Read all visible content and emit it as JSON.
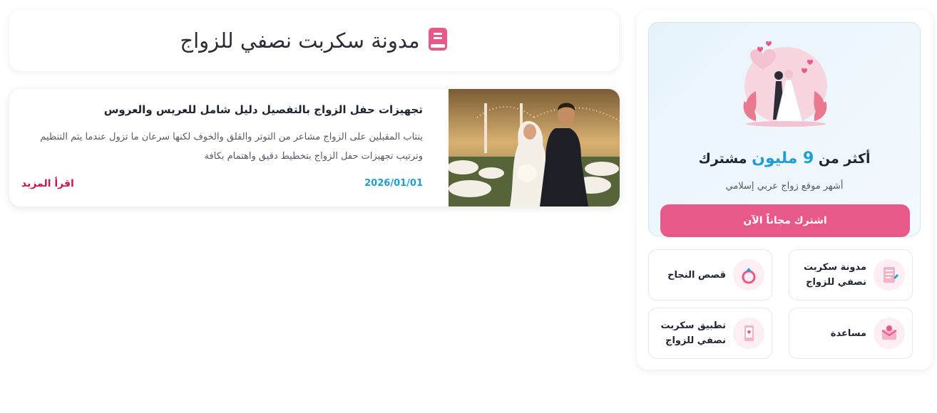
{
  "blog": {
    "title": "مدونة سكربت نصفي للزواج",
    "title_icon": "book-icon",
    "posts": [
      {
        "title": "تجهيزات حفل الزواج بالتفصيل دليل شامل للعريس والعروس",
        "excerpt": "ينتاب المقبلين على الزواج مشاعر من التوتر والقلق والخوف لكنها سرعان ما تزول عندما يتم التنظيم وترتيب تجهيزات حفل الزواج بتخطيط دقيق واهتمام بكافة",
        "date": "2026/01/01",
        "read_more": "اقرأ المزيد",
        "image": "wedding-couple-photo"
      }
    ]
  },
  "promo": {
    "prefix": "أكثر من",
    "highlight": "9 مليون",
    "suffix": "مشترك",
    "subtitle": "أشهر موقع زواج عربي إسلامي",
    "cta": "اشترك مجاناً الآن",
    "illustration": "wedding-couple-hearts"
  },
  "quick_links": [
    {
      "label": "مدونة سكربت نصفي للزواج",
      "icon": "blog-icon"
    },
    {
      "label": "قصص النجاح",
      "icon": "ring-icon"
    },
    {
      "label": "مساعدة",
      "icon": "help-envelope-icon"
    },
    {
      "label": "تطبيق سكربت نصفي للزواج",
      "icon": "mobile-app-icon"
    }
  ],
  "colors": {
    "accent_pink": "#e8598a",
    "highlight_blue": "#1e9ed9",
    "read_more_red": "#c8174e"
  }
}
